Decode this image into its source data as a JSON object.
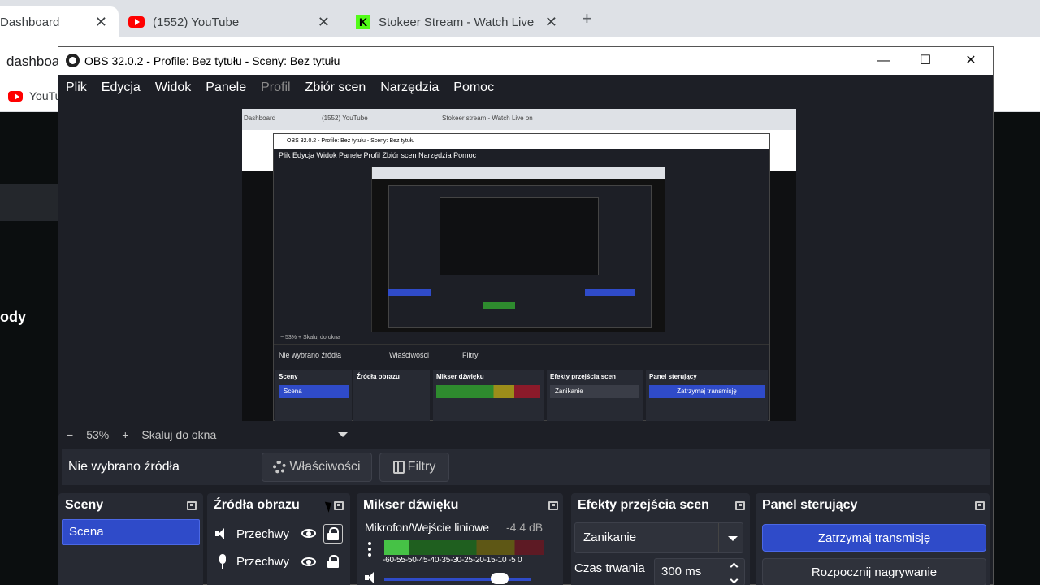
{
  "browser": {
    "tabs": [
      {
        "title": "Dashboard",
        "icon": "dashboard-icon"
      },
      {
        "title": "(1552) YouTube",
        "icon": "youtube-icon"
      },
      {
        "title": "Stokeer Stream - Watch Live on",
        "icon": "kick-icon"
      }
    ],
    "address": "dashboa",
    "bookmark": "YouTu",
    "page_text": "ody"
  },
  "obs": {
    "title": "OBS 32.0.2 - Profile: Bez tytułu - Sceny: Bez tytułu",
    "menu": [
      "Plik",
      "Edycja",
      "Widok",
      "Panele",
      "Profil",
      "Zbiór scen",
      "Narzędzia",
      "Pomoc"
    ],
    "zoom": {
      "minus": "−",
      "value": "53%",
      "plus": "+",
      "fit_label": "Skaluj do okna"
    },
    "source_bar": {
      "no_source": "Nie wybrano źródła",
      "properties": "Właściwości",
      "filters": "Filtry"
    },
    "docks": {
      "scenes": {
        "title": "Sceny",
        "items": [
          "Scena"
        ]
      },
      "sources": {
        "title": "Źródła obrazu",
        "items": [
          "Przechwy",
          "Przechwy"
        ]
      },
      "mixer": {
        "title": "Mikser dźwięku",
        "channel": "Mikrofon/Wejście liniowe",
        "db": "-4.4 dB",
        "scale": "-60-55-50-45-40-35-30-25-20-15-10 -5  0",
        "level": 0.16,
        "volume": 0.79
      },
      "transitions": {
        "title": "Efekty przejścia scen",
        "selected": "Zanikanie",
        "duration_label": "Czas trwania",
        "duration_value": "300 ms"
      },
      "controls": {
        "title": "Panel sterujący",
        "primary": "Zatrzymaj transmisję",
        "secondary": "Rozpocznij nagrywanie"
      }
    },
    "preview": {
      "tab1": "Dashboard",
      "tab2": "(1552) YouTube",
      "tab3": "Stokeer stream - Watch Live on",
      "title": "OBS 32.0.2 - Profile: Bez tytułu - Sceny: Bez tytułu",
      "menu": "Plik   Edycja   Widok   Panele   Profil   Zbiór scen   Narzędzia   Pomoc",
      "zoom": "−    53%    +    Skaluj do okna",
      "no_source": "Nie wybrano źródła",
      "properties": "Właściwości",
      "filters": "Filtry",
      "scenes": "Sceny",
      "scene_item": "Scena",
      "sources": "Źródła obrazu",
      "mixer": "Mikser dźwięku",
      "transitions": "Efekty przejścia scen",
      "transition_item": "Zanikanie",
      "controls": "Panel sterujący",
      "primary": "Zatrzymaj transmisję"
    }
  },
  "colors": {
    "accent": "#2f4bc9",
    "obs_bg": "#1d1f26",
    "dock_bg": "#272a33"
  }
}
